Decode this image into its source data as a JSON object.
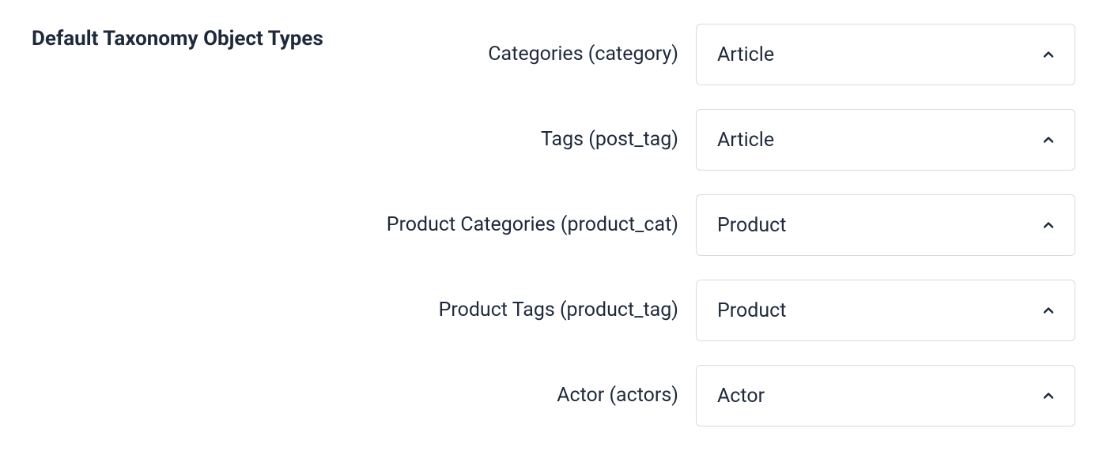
{
  "section_title": "Default Taxonomy Object Types",
  "fields": [
    {
      "label": "Categories (category)",
      "value": "Article"
    },
    {
      "label": "Tags (post_tag)",
      "value": "Article"
    },
    {
      "label": "Product Categories (product_cat)",
      "value": "Product"
    },
    {
      "label": "Product Tags (product_tag)",
      "value": "Product"
    },
    {
      "label": "Actor (actors)",
      "value": "Actor"
    }
  ]
}
